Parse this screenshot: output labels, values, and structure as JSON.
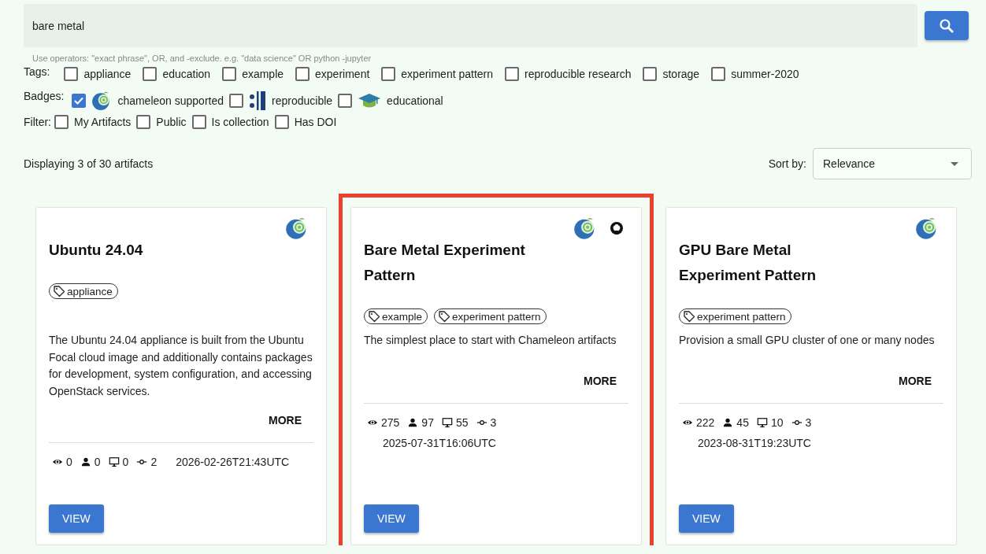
{
  "search": {
    "value": "bare metal",
    "hint": "Use operators: \"exact phrase\", OR, and -exclude. e.g. \"data science\" OR python -jupyter"
  },
  "tag_filters": {
    "label": "Tags:",
    "options": [
      {
        "label": "appliance",
        "checked": false
      },
      {
        "label": "education",
        "checked": false
      },
      {
        "label": "example",
        "checked": false
      },
      {
        "label": "experiment",
        "checked": false
      },
      {
        "label": "experiment pattern",
        "checked": false
      },
      {
        "label": "reproducible research",
        "checked": false
      },
      {
        "label": "storage",
        "checked": false
      },
      {
        "label": "summer-2020",
        "checked": false
      }
    ]
  },
  "badge_filters": {
    "label": "Badges:",
    "options": [
      {
        "label": "chameleon supported",
        "checked": true,
        "kind": "chameleon"
      },
      {
        "label": "reproducible",
        "checked": false,
        "kind": "reproducible"
      },
      {
        "label": "educational",
        "checked": false,
        "kind": "educational"
      }
    ]
  },
  "other_filters": {
    "label": "Filter:",
    "options": [
      {
        "label": "My Artifacts",
        "checked": false
      },
      {
        "label": "Public",
        "checked": false
      },
      {
        "label": "Is collection",
        "checked": false
      },
      {
        "label": "Has DOI",
        "checked": false
      }
    ]
  },
  "results": {
    "summary": "Displaying 3 of 30 artifacts",
    "sort_label": "Sort by:",
    "sort_value": "Relevance"
  },
  "cards": [
    {
      "title": "Ubuntu 24.04",
      "highlighted": false,
      "badges": [
        {
          "kind": "chameleon"
        }
      ],
      "tags": [
        "appliance"
      ],
      "description": "The Ubuntu 24.04 appliance is built from the Ubuntu Focal cloud image and additionally contains packages for development, system configuration, and accessing OpenStack services.",
      "more": "MORE",
      "stats": [
        {
          "kind": "views",
          "value": "0"
        },
        {
          "kind": "users",
          "value": "0"
        },
        {
          "kind": "launches",
          "value": "0"
        },
        {
          "kind": "versions",
          "value": "2"
        }
      ],
      "date": "2026-02-26T21:43UTC",
      "button": "VIEW"
    },
    {
      "title": "Bare Metal Experiment Pattern",
      "highlighted": true,
      "badges": [
        {
          "kind": "chameleon"
        },
        {
          "kind": "repository"
        }
      ],
      "tags": [
        "example",
        "experiment pattern"
      ],
      "description": "The simplest place to start with Chameleon artifacts",
      "more": "MORE",
      "stats": [
        {
          "kind": "views",
          "value": "275"
        },
        {
          "kind": "users",
          "value": "97"
        },
        {
          "kind": "launches",
          "value": "55"
        },
        {
          "kind": "versions",
          "value": "3"
        }
      ],
      "date": "2025-07-31T16:06UTC",
      "button": "VIEW"
    },
    {
      "title": "GPU Bare Metal Experiment Pattern",
      "highlighted": false,
      "badges": [
        {
          "kind": "chameleon"
        }
      ],
      "tags": [
        "experiment pattern"
      ],
      "description": "Provision a small GPU cluster of one or many nodes",
      "more": "MORE",
      "stats": [
        {
          "kind": "views",
          "value": "222"
        },
        {
          "kind": "users",
          "value": "45"
        },
        {
          "kind": "launches",
          "value": "10"
        },
        {
          "kind": "versions",
          "value": "3"
        }
      ],
      "date": "2023-08-31T19:23UTC",
      "button": "VIEW"
    }
  ]
}
